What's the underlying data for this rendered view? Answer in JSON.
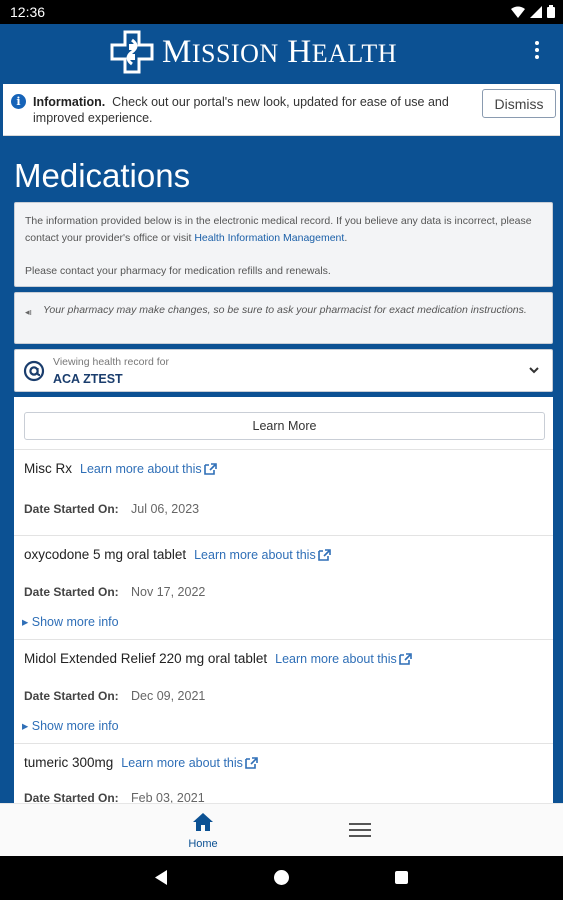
{
  "status_bar": {
    "time": "12:36"
  },
  "header": {
    "logo_text_first": "M",
    "logo_text_rest1": "ISSION",
    "logo_text_h": "H",
    "logo_text_rest2": "EALTH"
  },
  "banner": {
    "title": "Information.",
    "message": "Check out our portal's new look, updated for ease of use and improved experience.",
    "dismiss_label": "Dismiss"
  },
  "page": {
    "title": "Medications"
  },
  "disclaimer": {
    "text1": "The information provided below is in the electronic medical record. If you believe any data is incorrect, please contact your provider's office or visit ",
    "link": "Health Information Management",
    "text1_end": ".",
    "text2": "Please contact your pharmacy for medication refills and renewals."
  },
  "pharmacy_note": "Your pharmacy may make changes, so be sure to ask your pharmacist for exact medication instructions.",
  "viewing": {
    "label": "Viewing health record for",
    "name": "ACA ZTEST"
  },
  "learn_more_button": "Learn More",
  "medications": [
    {
      "name": "Misc Rx",
      "link": "Learn more about this",
      "date_label": "Date Started On:",
      "date": "Jul 06, 2023"
    },
    {
      "name": "oxycodone 5 mg oral tablet",
      "link": "Learn more about this",
      "date_label": "Date Started On:",
      "date": "Nov 17, 2022",
      "more": "Show more info"
    },
    {
      "name": "Midol Extended Relief 220 mg oral tablet",
      "link": "Learn more about this",
      "date_label": "Date Started On:",
      "date": "Dec 09, 2021",
      "more": "Show more info"
    },
    {
      "name": "tumeric 300mg",
      "link": "Learn more about this",
      "date_label": "Date Started On:",
      "date": "Feb 03, 2021"
    }
  ],
  "tab_bar": {
    "home_label": "Home"
  },
  "icons": {
    "info": "info-circle-icon",
    "megaphone": "megaphone-icon",
    "at": "at-sign-icon",
    "chevron": "chevron-down-icon",
    "external": "external-link-icon",
    "home": "home-icon",
    "menu": "hamburger-menu-icon"
  },
  "colors": {
    "brand": "#0c5193",
    "link": "#2f6fb7",
    "banner_icon": "#1663b8"
  }
}
